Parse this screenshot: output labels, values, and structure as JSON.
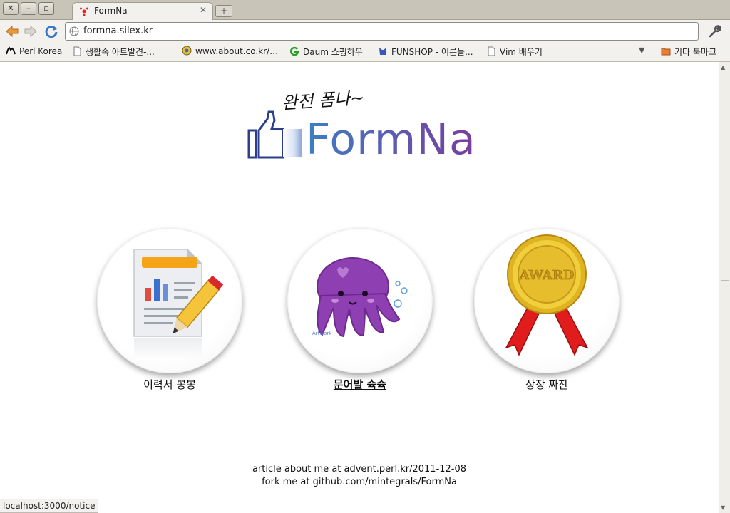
{
  "browser": {
    "tab_title": "FormNa",
    "url": "formna.silex.kr",
    "status_text": "localhost:3000/notice",
    "bookmarks": [
      {
        "label": "Perl Korea",
        "icon": "camel-icon"
      },
      {
        "label": "생활속 아트발견-...",
        "icon": "page-icon"
      },
      {
        "label": "www.about.co.kr/…",
        "icon": "globe-icon"
      },
      {
        "label": "Daum 쇼핑하우",
        "icon": "g-icon"
      },
      {
        "label": "FUNSHOP - 어른들...",
        "icon": "funshop-icon"
      },
      {
        "label": "Vim 배우기",
        "icon": "page-icon"
      }
    ],
    "more_bookmarks_label": "기타 북마크"
  },
  "page": {
    "logo_slogan": "완전 폼나~",
    "logo_text": "FormNa",
    "cards": [
      {
        "label": "이력서 뽕뽕",
        "icon": "resume-icon"
      },
      {
        "label": "문어발 슉슉",
        "icon": "octopus-icon"
      },
      {
        "label": "상장 짜잔",
        "icon": "award-icon"
      }
    ],
    "octopus_caption": "Artwork",
    "award_text": "AWARD",
    "footer_line1": "article about me at advent.perl.kr/2011-12-08",
    "footer_line2": "fork me at github.com/mintegrals/FormNa"
  }
}
